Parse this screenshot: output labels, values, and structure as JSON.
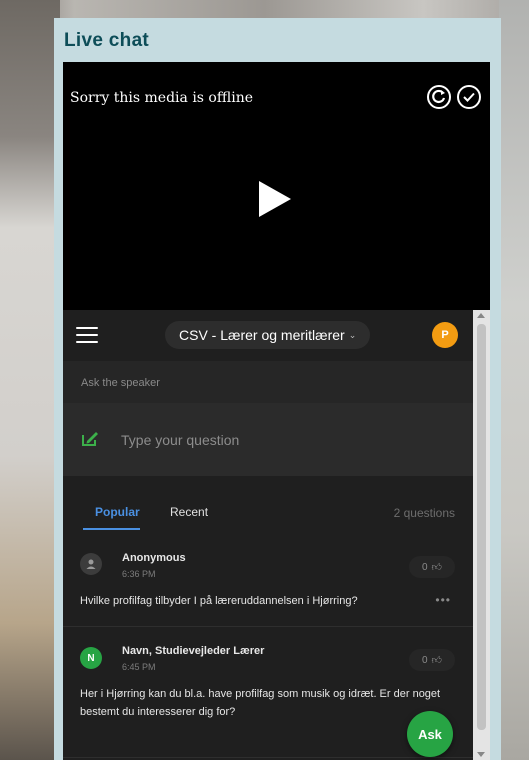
{
  "panel": {
    "title": "Live chat"
  },
  "media": {
    "offline_text": "Sorry this media is offline"
  },
  "app": {
    "event_select": "CSV - Lærer og meritlærer",
    "user_initial": "P",
    "ask_label": "Ask the speaker",
    "question_placeholder": "Type your question",
    "tabs": [
      {
        "label": "Popular",
        "active": true
      },
      {
        "label": "Recent",
        "active": false
      }
    ],
    "question_count": "2 questions",
    "questions": [
      {
        "author": "Anonymous",
        "time": "6:36 PM",
        "likes": "0",
        "text": "Hvilke profilfag tilbyder I på læreruddannelsen i Hjørring?"
      },
      {
        "author": "Navn, Studievejleder Lærer",
        "avatar_initial": "N",
        "time": "6:45 PM",
        "likes": "0",
        "text": "Her i Hjørring kan du bl.a. have profilfag som musik og idræt. Er der noget bestemt du interesserer dig for?"
      }
    ],
    "ask_button": "Ask",
    "colors": {
      "accent_blue": "#4a90e2",
      "green": "#27a444",
      "avatar_orange": "#f39c12",
      "title_teal": "#0d4d58"
    }
  }
}
